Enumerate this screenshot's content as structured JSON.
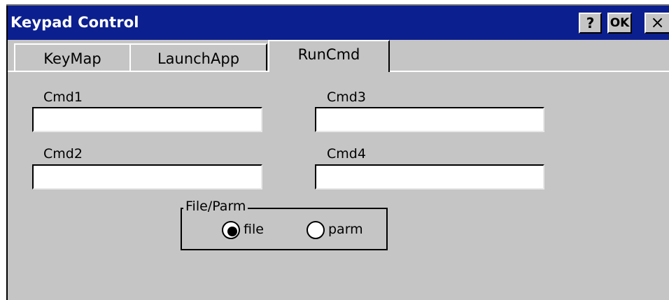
{
  "window": {
    "title": "Keypad Control",
    "buttons": {
      "help": "?",
      "ok": "OK",
      "close": "×"
    }
  },
  "tabs": [
    {
      "label": "KeyMap",
      "active": false
    },
    {
      "label": "LaunchApp",
      "active": false
    },
    {
      "label": "RunCmd",
      "active": true
    }
  ],
  "fields": {
    "cmd1": {
      "label": "Cmd1",
      "value": ""
    },
    "cmd2": {
      "label": "Cmd2",
      "value": ""
    },
    "cmd3": {
      "label": "Cmd3",
      "value": ""
    },
    "cmd4": {
      "label": "Cmd4",
      "value": ""
    }
  },
  "file_parm": {
    "title": "File/Parm",
    "options": [
      {
        "label": "file",
        "selected": true
      },
      {
        "label": "parm",
        "selected": false
      }
    ]
  },
  "colors": {
    "titlebar": "#0c1f8f",
    "face": "#c5c5c5"
  }
}
